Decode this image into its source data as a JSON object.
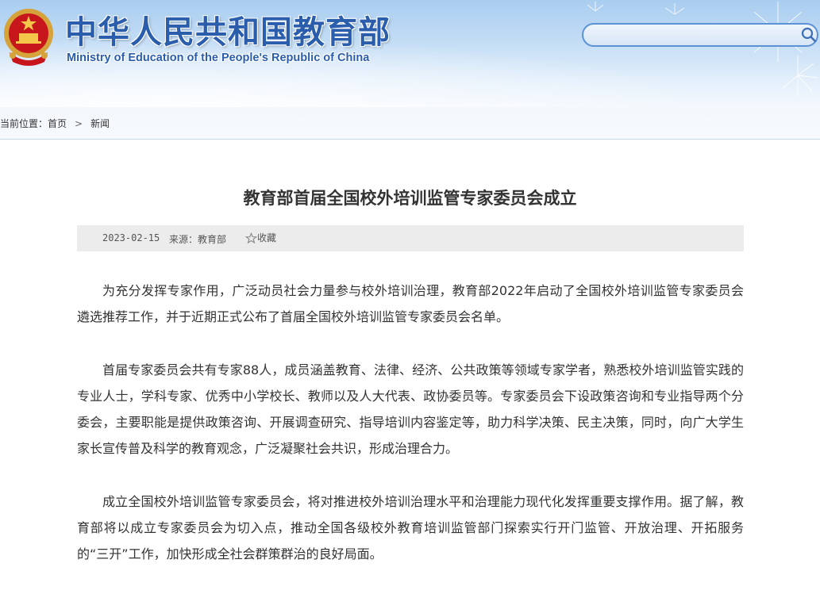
{
  "header": {
    "title": "中华人民共和国教育部",
    "subtitle": "Ministry of Education of the People's Republic of China",
    "emblem_icon": "national-emblem-icon",
    "search": {
      "placeholder": "",
      "value": "",
      "icon": "search-icon"
    }
  },
  "breadcrumb": {
    "prefix": "当前位置：",
    "items": [
      "首页",
      "新闻"
    ],
    "separator": ">"
  },
  "article": {
    "title": "教育部首届全国校外培训监管专家委员会成立",
    "date": "2023-02-15",
    "source": "来源：教育部",
    "favorite_label": "收藏",
    "favorite_icon": "star-icon",
    "paragraphs": [
      "为充分发挥专家作用，广泛动员社会力量参与校外培训治理，教育部2022年启动了全国校外培训监管专家委员会遴选推荐工作，并于近期正式公布了首届全国校外培训监管专家委员会名单。",
      "首届专家委员会共有专家88人，成员涵盖教育、法律、经济、公共政策等领域专家学者，熟悉校外培训监管实践的专业人士，学科专家、优秀中小学校长、教师以及人大代表、政协委员等。专家委员会下设政策咨询和专业指导两个分委会，主要职能是提供政策咨询、开展调查研究、指导培训内容鉴定等，助力科学决策、民主决策，同时，向广大学生家长宣传普及科学的教育观念，广泛凝聚社会共识，形成治理合力。",
      "成立全国校外培训监管专家委员会，将对推进校外培训治理水平和治理能力现代化发挥重要支撑作用。据了解，教育部将以成立专家委员会为切入点，推动全国各级校外教育培训监管部门探索实行开门监管、开放治理、开拓服务的“三开”工作，加快形成全社会群策群治的良好局面。"
    ]
  },
  "colors": {
    "brand_blue": "#2a5dab",
    "meta_bg": "#ececec",
    "header_sky": "#a9cdf0"
  }
}
